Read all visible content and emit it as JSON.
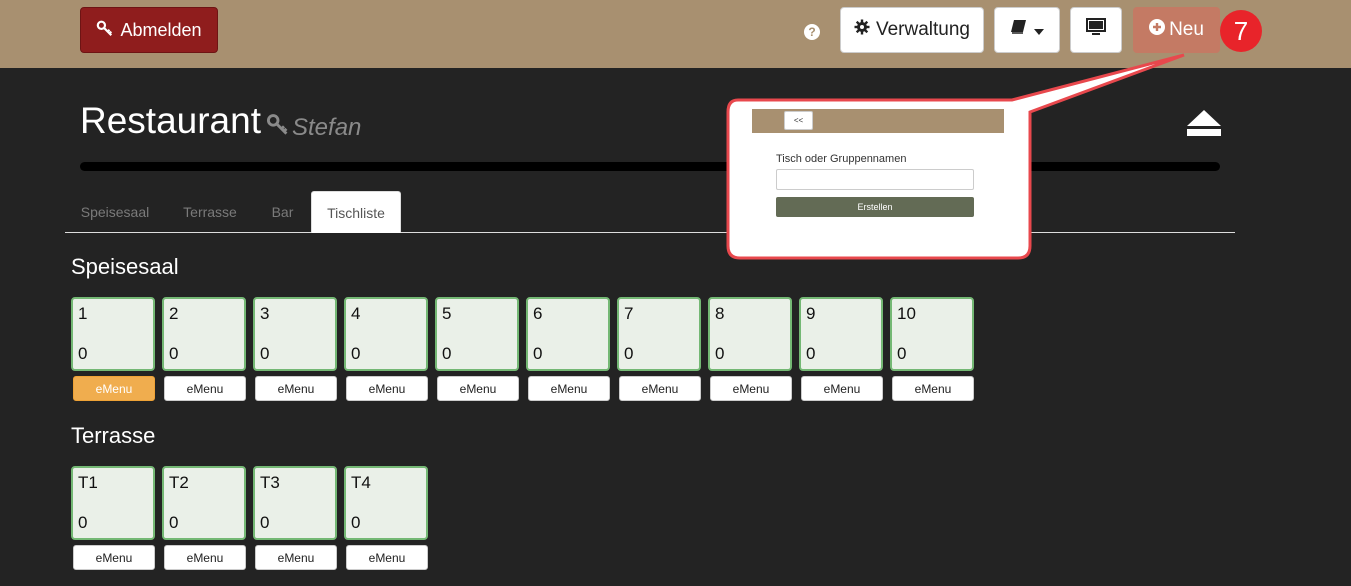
{
  "header": {
    "logout_label": "Abmelden",
    "help_icon": "?",
    "admin_label": "Verwaltung",
    "new_label": "Neu",
    "step_badge": "7"
  },
  "page": {
    "title": "Restaurant",
    "user": "Stefan"
  },
  "tabs": [
    {
      "label": "Speisesaal",
      "active": false
    },
    {
      "label": "Terrasse",
      "active": false
    },
    {
      "label": "Bar",
      "active": false
    },
    {
      "label": "Tischliste",
      "active": true
    }
  ],
  "sections": [
    {
      "title": "Speisesaal",
      "tables": [
        {
          "name": "1",
          "count": "0",
          "button": "eMenu",
          "active": true
        },
        {
          "name": "2",
          "count": "0",
          "button": "eMenu",
          "active": false
        },
        {
          "name": "3",
          "count": "0",
          "button": "eMenu",
          "active": false
        },
        {
          "name": "4",
          "count": "0",
          "button": "eMenu",
          "active": false
        },
        {
          "name": "5",
          "count": "0",
          "button": "eMenu",
          "active": false
        },
        {
          "name": "6",
          "count": "0",
          "button": "eMenu",
          "active": false
        },
        {
          "name": "7",
          "count": "0",
          "button": "eMenu",
          "active": false
        },
        {
          "name": "8",
          "count": "0",
          "button": "eMenu",
          "active": false
        },
        {
          "name": "9",
          "count": "0",
          "button": "eMenu",
          "active": false
        },
        {
          "name": "10",
          "count": "0",
          "button": "eMenu",
          "active": false
        }
      ]
    },
    {
      "title": "Terrasse",
      "tables": [
        {
          "name": "T1",
          "count": "0",
          "button": "eMenu",
          "active": false
        },
        {
          "name": "T2",
          "count": "0",
          "button": "eMenu",
          "active": false
        },
        {
          "name": "T3",
          "count": "0",
          "button": "eMenu",
          "active": false
        },
        {
          "name": "T4",
          "count": "0",
          "button": "eMenu",
          "active": false
        }
      ]
    }
  ],
  "popup": {
    "back_label": "<<",
    "field_label": "Tisch oder Gruppennamen",
    "field_value": "",
    "submit_label": "Erstellen"
  },
  "colors": {
    "topbar": "#a89070",
    "logout": "#8f1d1d",
    "new_button": "#c47a64",
    "badge": "#e8242a",
    "table_border": "#74b874",
    "emenu_active": "#f0ad4e"
  }
}
